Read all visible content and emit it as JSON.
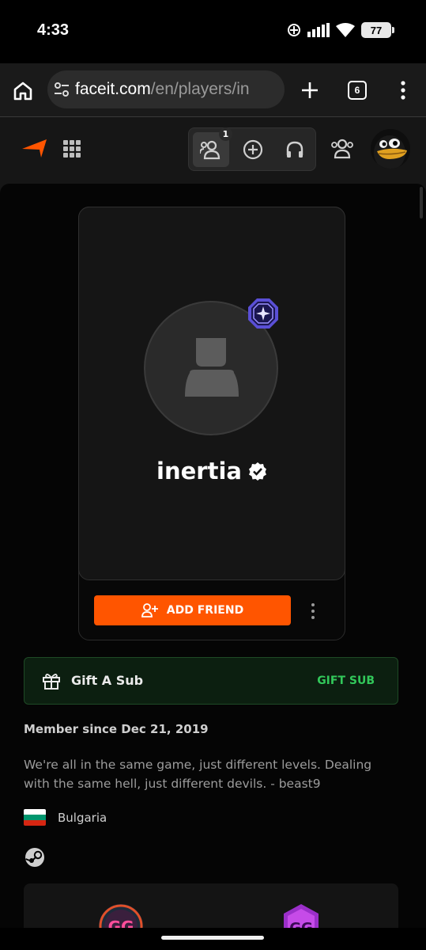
{
  "status_bar": {
    "time": "4:33",
    "battery": "77",
    "icons": [
      "nfc-icon",
      "signal-icon",
      "wifi-icon",
      "battery-icon"
    ]
  },
  "browser": {
    "url_host": "faceit.com",
    "url_path": "/en/players/in",
    "tab_count": "6"
  },
  "header": {
    "notification_count": "1"
  },
  "profile": {
    "nickname": "inertia",
    "add_friend_label": "ADD FRIEND"
  },
  "gift": {
    "label": "Gift A Sub",
    "action": "GIFT SUB"
  },
  "about": {
    "member_since": "Member since Dec 21, 2019",
    "bio": "We're all in the same game, just different levels. Dealing with the same hell, just different devils. - beast9",
    "country": "Bulgaria"
  },
  "colors": {
    "accent": "#ff5500",
    "gift_green": "#32c85a",
    "flag_white": "#ffffff",
    "flag_green": "#00966e",
    "flag_red": "#d62612"
  }
}
